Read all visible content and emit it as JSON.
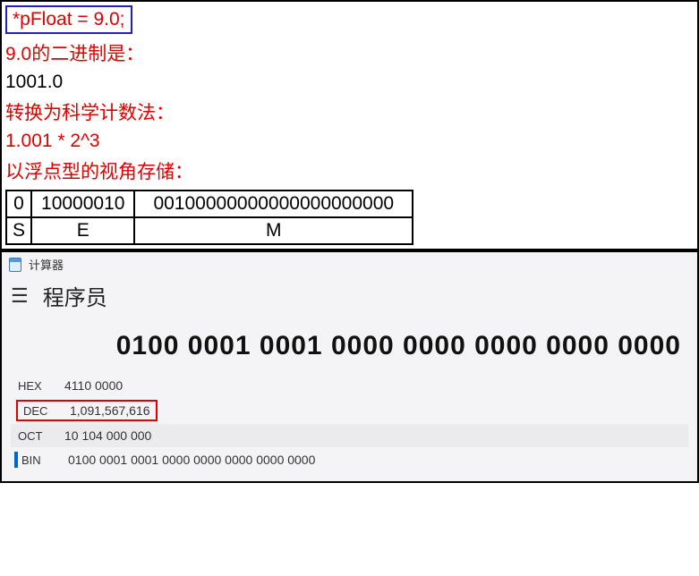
{
  "top": {
    "code_assignment": "*pFloat = 9.0;",
    "binary_label": "9.0的二进制是：",
    "binary_value": "1001.0",
    "sci_label": "转换为科学计数法：",
    "sci_value": "1.001 * 2^3",
    "float_view_label": "以浮点型的视角存储：",
    "ieee": {
      "sign": "0",
      "exponent": "10000010",
      "mantissa": "00100000000000000000000",
      "sign_label": "S",
      "exponent_label": "E",
      "mantissa_label": "M"
    }
  },
  "calc": {
    "app_title": "计算器",
    "mode": "程序员",
    "display": "0100 0001 0001 0000 0000 0000 0000 0000",
    "hex": {
      "label": "HEX",
      "value": "4110 0000"
    },
    "dec": {
      "label": "DEC",
      "value": "1,091,567,616"
    },
    "oct": {
      "label": "OCT",
      "value": "10 104 000 000"
    },
    "bin": {
      "label": "BIN",
      "value": "0100 0001 0001 0000 0000 0000 0000 0000"
    }
  }
}
